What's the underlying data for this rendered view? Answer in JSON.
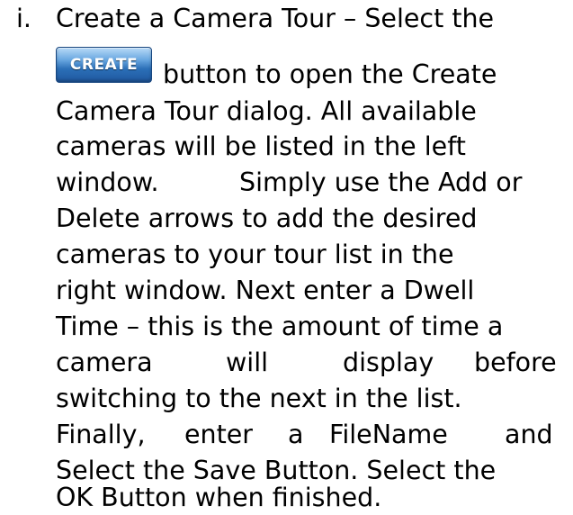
{
  "list_marker": "i.",
  "create_button_label": "CREATE",
  "paragraph": {
    "l1": "Create a Camera Tour – Select the",
    "l2": "button to open the Create",
    "l3": "Camera Tour dialog.  All available",
    "l4": "cameras will be listed in the left",
    "l5a": "window.",
    "l5b": "Simply use the Add or",
    "l6": "Delete arrows to add the desired",
    "l7": "cameras to your tour list in the",
    "l8": "right window.  Next enter a Dwell",
    "l9": "Time – this is the amount of time a",
    "l10a": "camera",
    "l10b": "will",
    "l10c": "display",
    "l10d": "before",
    "l11": "switching to the next in the list.",
    "l12a": "Finally,",
    "l12b": "enter",
    "l12c": "a",
    "l12d": "FileName",
    "l12e": "and",
    "l13": "Select the Save Button.  Select the",
    "l14": "OK Button when finished."
  }
}
